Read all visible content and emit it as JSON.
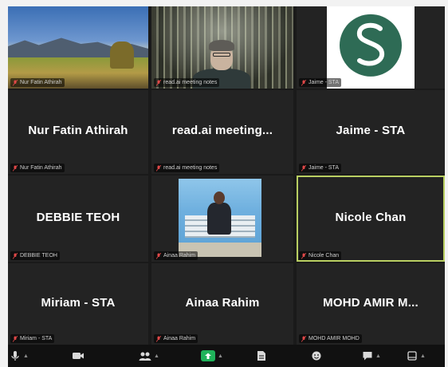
{
  "tiles": [
    {
      "id": "t1",
      "type": "video",
      "scene": "landscape",
      "label": "Nur Fatin Athirah"
    },
    {
      "id": "t2",
      "type": "video",
      "scene": "person",
      "label": "read.ai meeting notes"
    },
    {
      "id": "t3",
      "type": "logo",
      "label": "Jaime - STA"
    },
    {
      "id": "t4",
      "type": "name",
      "name": "Nur Fatin Athirah",
      "label": "Nur Fatin Athirah"
    },
    {
      "id": "t5",
      "type": "name",
      "name": "read.ai meeting...",
      "label": "read.ai meeting notes"
    },
    {
      "id": "t6",
      "type": "name",
      "name": "Jaime - STA",
      "label": "Jaime - STA"
    },
    {
      "id": "t7",
      "type": "name",
      "name": "DEBBIE TEOH",
      "label": "DEBBIE TEOH"
    },
    {
      "id": "t8",
      "type": "photo",
      "label": "Ainaa Rahim"
    },
    {
      "id": "t9",
      "type": "name",
      "name": "Nicole Chan",
      "label": "Nicole Chan",
      "active": true
    },
    {
      "id": "t10",
      "type": "name",
      "name": "Miriam - STA",
      "label": "Miriam - STA"
    },
    {
      "id": "t11",
      "type": "name",
      "name": "Ainaa Rahim",
      "label": "Ainaa Rahim"
    },
    {
      "id": "t12",
      "type": "name",
      "name": "MOHD AMIR M...",
      "label": "MOHD AMIR MOHD"
    }
  ],
  "colors": {
    "tile_bg": "#232323",
    "active_border": "#b9cf62",
    "share_green": "#1fb25a",
    "logo_green": "#2e6b55"
  },
  "toolbar": {
    "icons": [
      "mic-icon",
      "video-icon",
      "participants-icon",
      "share-screen-icon",
      "document-icon",
      "reactions-icon",
      "chat-icon",
      "more-icon"
    ]
  }
}
